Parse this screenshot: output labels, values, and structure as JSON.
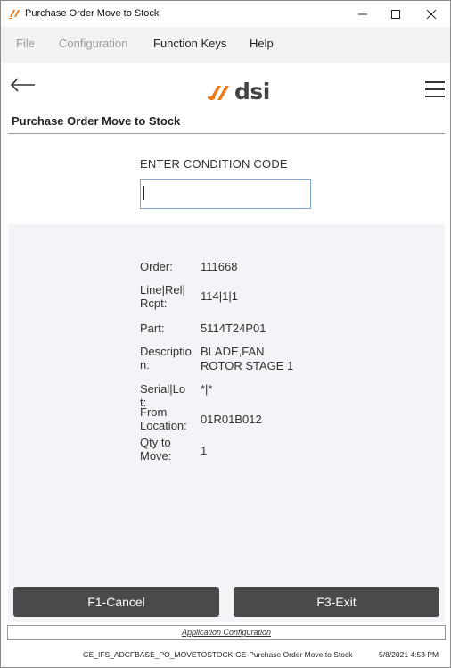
{
  "window": {
    "title": "Purchase Order Move to Stock",
    "minimize": "—",
    "maximize": "☐",
    "close": "✕"
  },
  "menu": {
    "file": "File",
    "configuration": "Configuration",
    "function_keys": "Function Keys",
    "help": "Help"
  },
  "header": {
    "logo_text": "dsi",
    "screen_title": "Purchase Order Move to Stock"
  },
  "entry": {
    "label": "ENTER CONDITION CODE",
    "value": ""
  },
  "info": {
    "order_label": "Order:",
    "order_value": "111668",
    "line_label": "Line|Rel| Rcpt:",
    "line_value": "114|1|1",
    "part_label": "Part:",
    "part_value": "5114T24P01",
    "desc_label": "Descriptio n:",
    "desc_value_1": "BLADE,FAN",
    "desc_value_2": "ROTOR STAGE 1",
    "serial_label": "Serial|Lot:",
    "serial_value": "*|*",
    "from_label": "From Location:",
    "from_value": "01R01B012",
    "qty_label": "Qty to Move:",
    "qty_value": "1"
  },
  "buttons": {
    "cancel": "F1-Cancel",
    "exit": "F3-Exit"
  },
  "footer": {
    "app_config": "Application Configuration",
    "status_left": "GE_IFS_ADCFBASE_PO_MOVETOSTOCK-GE-Purchase Order Move to Stock",
    "status_right": "5/8/2021 4:53 PM"
  },
  "colors": {
    "brand_orange": "#f07a1a",
    "button_bg": "#4a4a4d",
    "info_bg": "#f3f3f8"
  },
  "icons": {
    "app": "dsi-logo-icon",
    "back": "back-arrow-icon",
    "menu": "hamburger-menu-icon"
  }
}
